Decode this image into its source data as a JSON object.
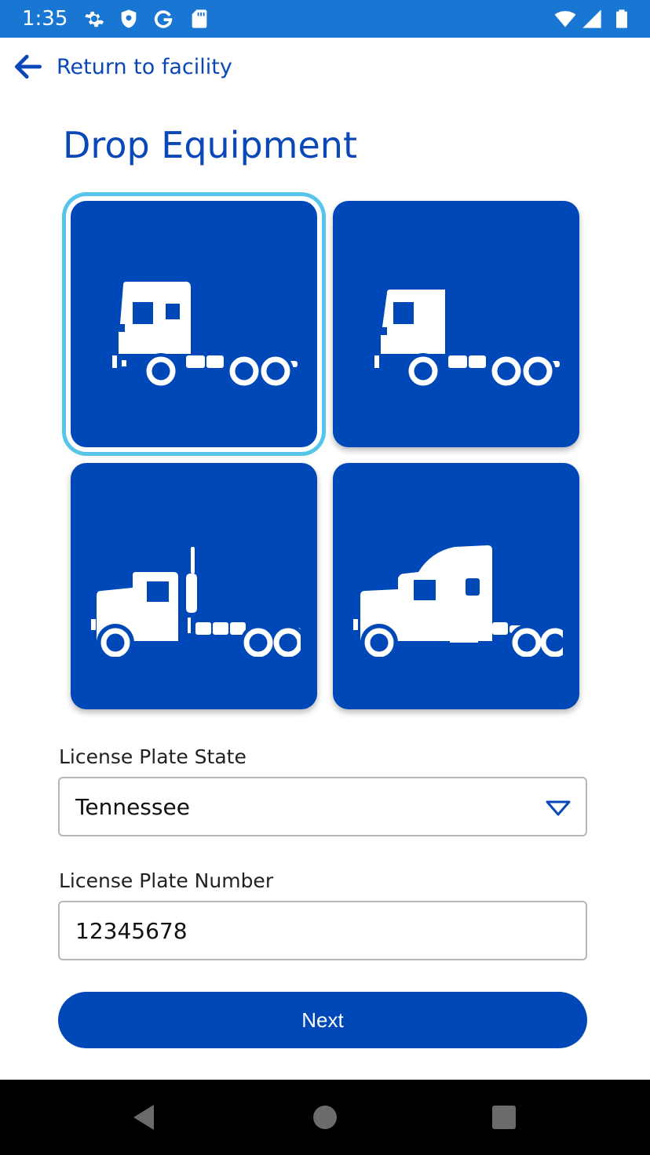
{
  "status_bar": {
    "time": "1:35",
    "left_icons": [
      "gear-icon",
      "shield-icon",
      "google-icon",
      "sd-card-icon"
    ],
    "right_icons": [
      "wifi-icon",
      "cell-signal-icon",
      "battery-icon"
    ],
    "background_color": "#1976d2"
  },
  "header": {
    "back_label": "Return to facility",
    "back_icon": "arrow-left-icon"
  },
  "page": {
    "title": "Drop Equipment"
  },
  "equipment_tiles": [
    {
      "id": "cab-over-truck",
      "icon": "cab-over-truck-icon",
      "selected": true
    },
    {
      "id": "flat-cab-truck",
      "icon": "flat-cab-truck-icon",
      "selected": false
    },
    {
      "id": "conventional-truck",
      "icon": "conventional-truck-icon",
      "selected": false
    },
    {
      "id": "sleeper-truck",
      "icon": "sleeper-truck-icon",
      "selected": false
    }
  ],
  "form": {
    "state_label": "License Plate State",
    "state_value": "Tennessee",
    "plate_label": "License Plate Number",
    "plate_value": "12345678",
    "next_label": "Next"
  },
  "nav_bar": {
    "buttons": [
      "back-triangle-icon",
      "home-circle-icon",
      "recents-square-icon"
    ]
  },
  "colors": {
    "primary": "#0048b8",
    "title_blue": "#0a47b8",
    "selected_ring": "#56c5ea",
    "border_gray": "#b7b7b7"
  }
}
